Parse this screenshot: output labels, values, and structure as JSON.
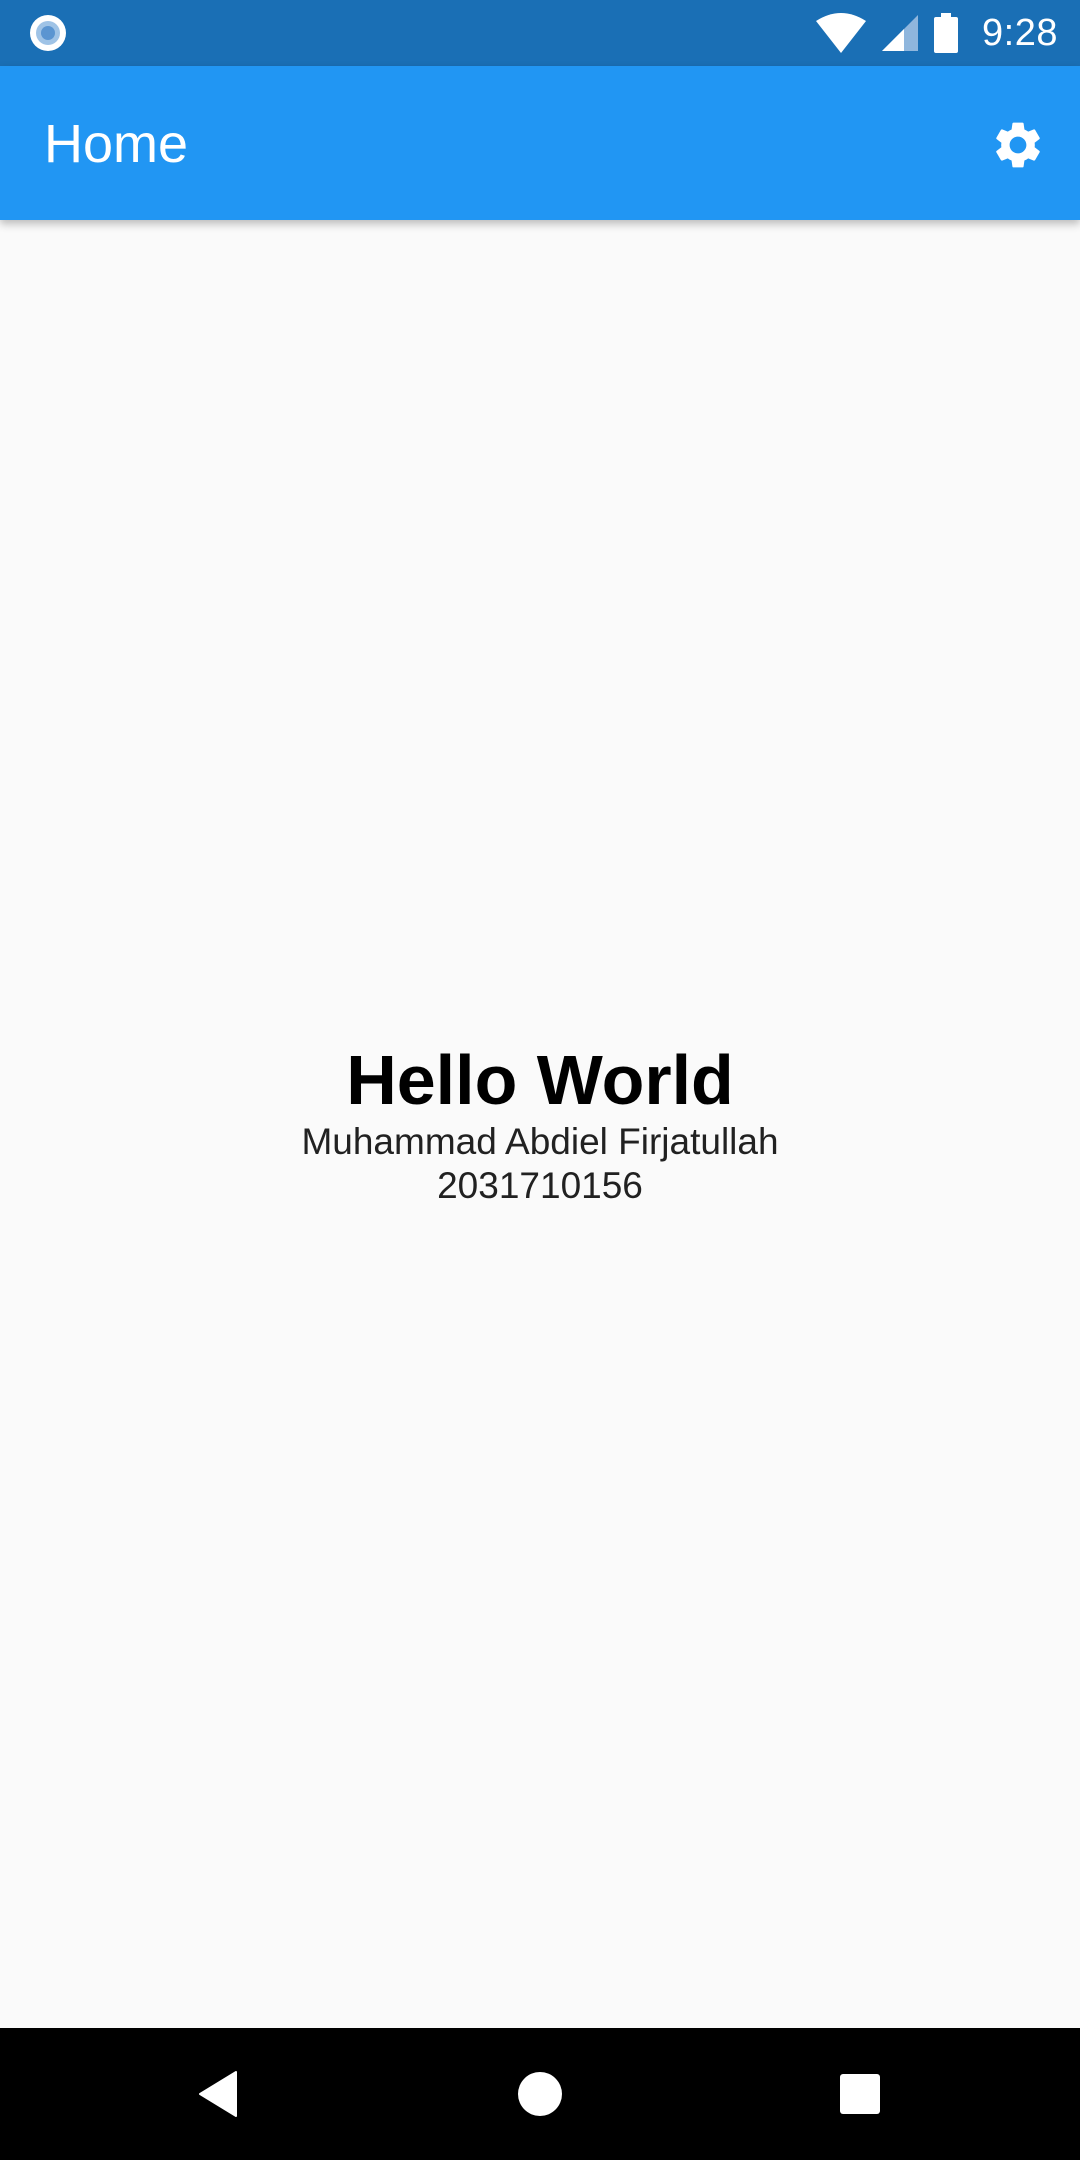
{
  "status_bar": {
    "time": "9:28",
    "left_icon": "circle-record-icon",
    "icons": [
      "wifi-icon",
      "cellular-signal-icon",
      "battery-icon"
    ],
    "color": "#1a6fb5"
  },
  "app_bar": {
    "title": "Home",
    "action_icon": "gear-icon",
    "color": "#2196f3"
  },
  "main": {
    "headline": "Hello World",
    "name": "Muhammad Abdiel Firjatullah",
    "id_number": "2031710156"
  },
  "nav_bar": {
    "buttons": [
      "back-icon",
      "home-icon",
      "recents-icon"
    ]
  }
}
